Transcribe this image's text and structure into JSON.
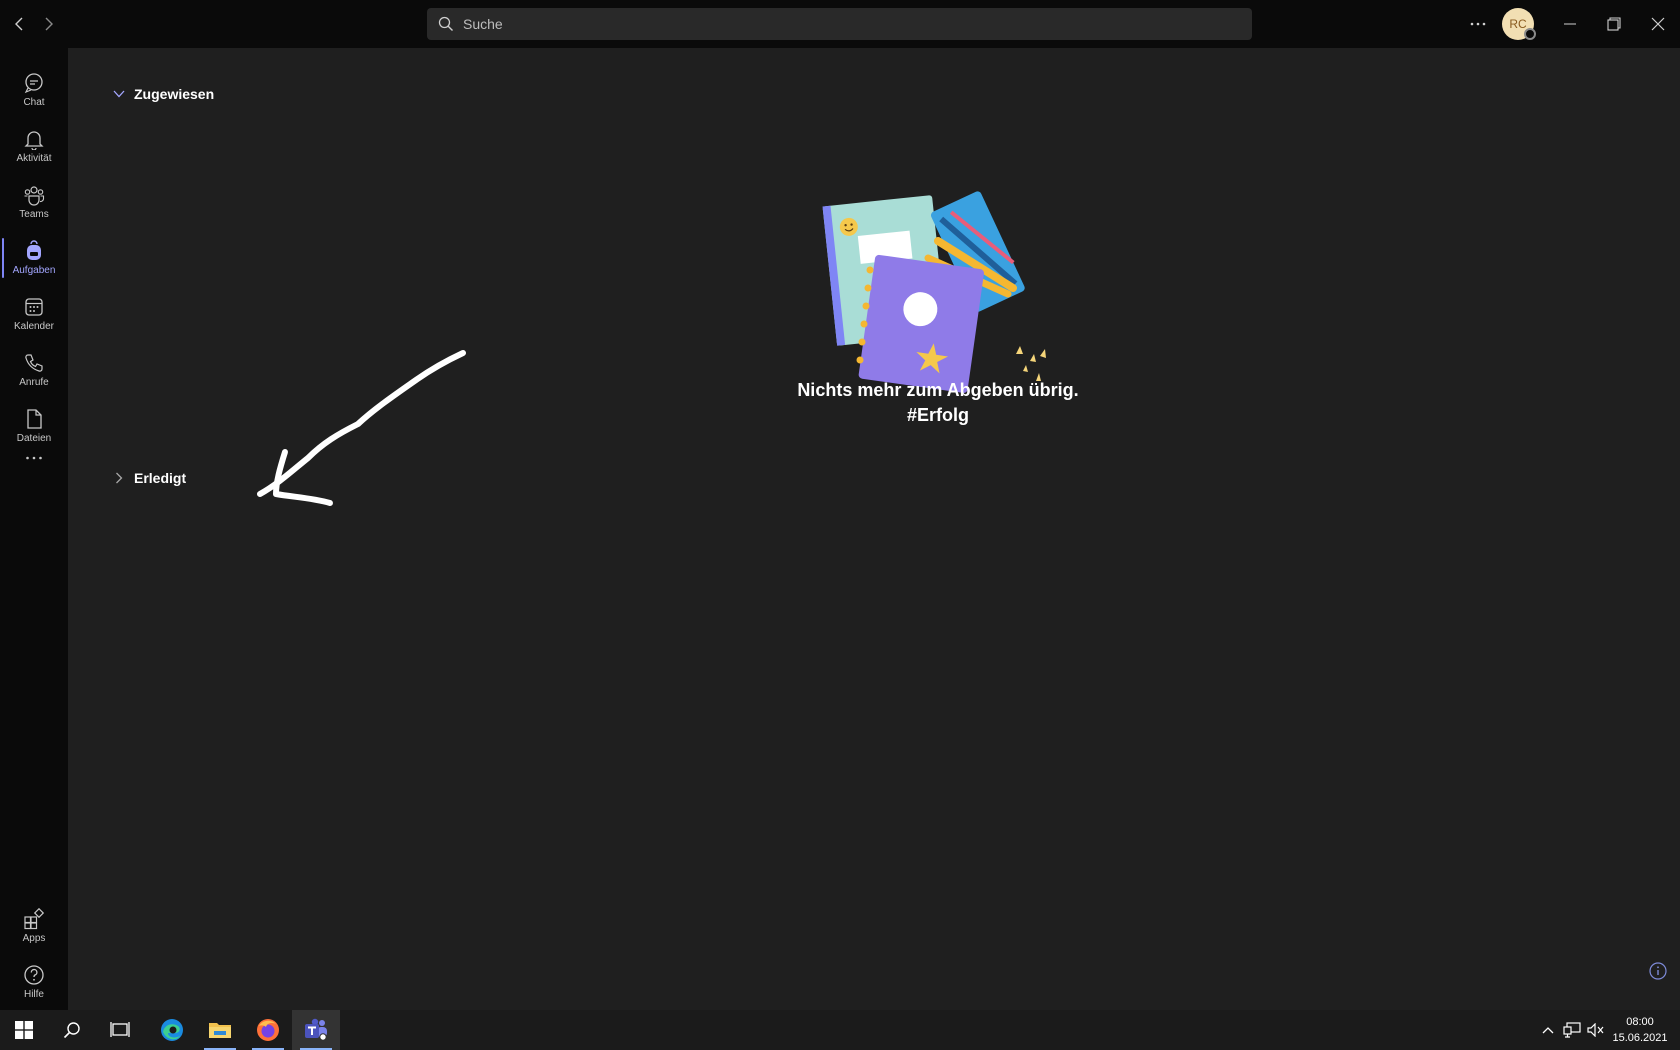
{
  "search": {
    "placeholder": "Suche"
  },
  "user": {
    "initials": "RC"
  },
  "rail": {
    "items": [
      {
        "label": "Chat",
        "icon": "chat-icon"
      },
      {
        "label": "Aktivität",
        "icon": "bell-icon"
      },
      {
        "label": "Teams",
        "icon": "teams-icon"
      },
      {
        "label": "Aufgaben",
        "icon": "backpack-icon",
        "active": true
      },
      {
        "label": "Kalender",
        "icon": "calendar-icon"
      },
      {
        "label": "Anrufe",
        "icon": "phone-icon"
      },
      {
        "label": "Dateien",
        "icon": "file-icon"
      }
    ],
    "apps_label": "Apps",
    "help_label": "Hilfe"
  },
  "main": {
    "assigned_label": "Zugewiesen",
    "done_label": "Erledigt",
    "empty_line1": "Nichts mehr zum Abgeben übrig.",
    "empty_line2": "#Erfolg"
  },
  "taskbar": {
    "time": "08:00",
    "date": "15.06.2021"
  },
  "colors": {
    "accent": "#7f85f5",
    "rail_bg": "#0a0a0a",
    "main_bg": "#1f1f1f"
  }
}
